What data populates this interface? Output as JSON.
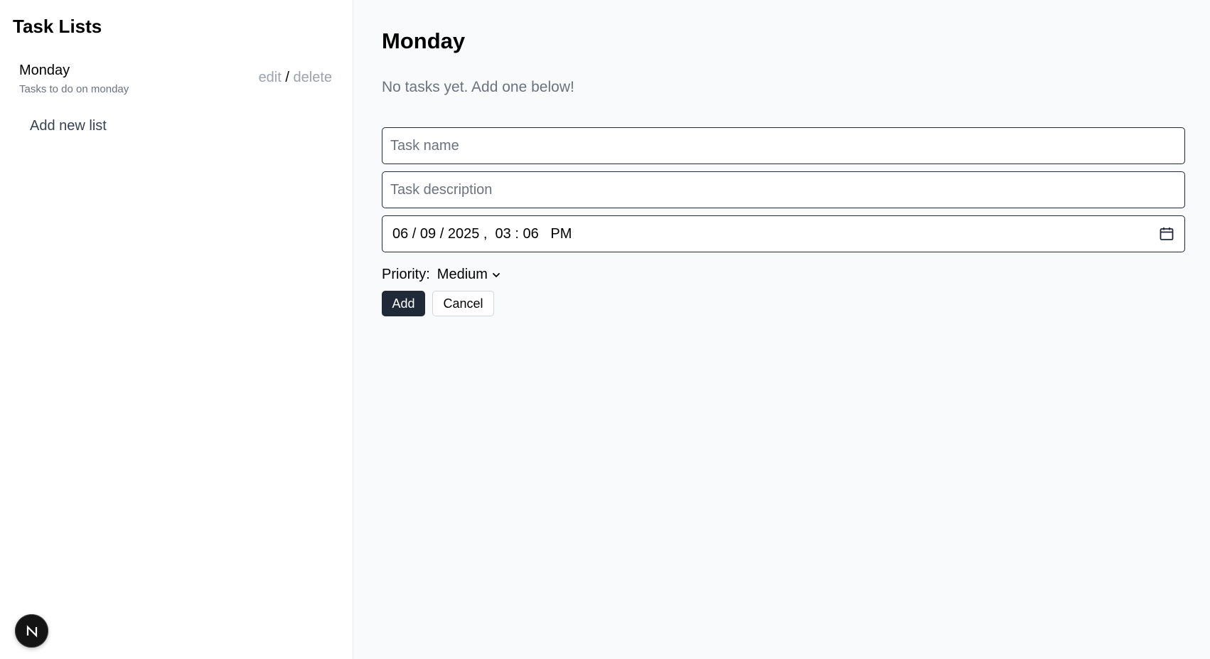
{
  "sidebar": {
    "title": "Task Lists",
    "lists": [
      {
        "name": "Monday",
        "description": "Tasks to do on monday",
        "edit_label": "edit",
        "separator": "/",
        "delete_label": "delete"
      }
    ],
    "add_list_label": "Add new list",
    "badge_letter": "N"
  },
  "main": {
    "title": "Monday",
    "empty_message": "No tasks yet. Add one below!",
    "form": {
      "task_name_placeholder": "Task name",
      "task_description_placeholder": "Task description",
      "datetime_value": "06 / 09 / 2025 ,  03 : 06   PM",
      "priority_label": "Priority:",
      "priority_value": "Medium",
      "add_label": "Add",
      "cancel_label": "Cancel"
    }
  },
  "colors": {
    "primary_button": "#1f2937",
    "main_background": "#f9fafb",
    "muted_text": "#6b7280"
  }
}
